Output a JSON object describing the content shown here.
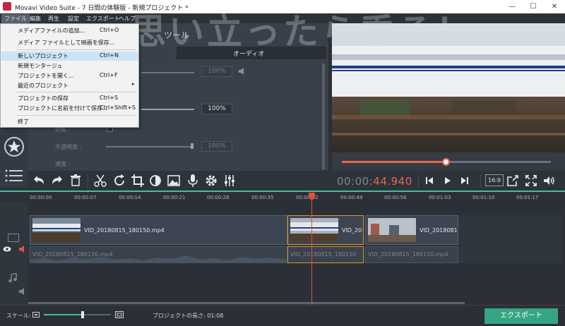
{
  "window": {
    "title": "Movavi Video Suite - 7 日間の体験版 - 新規プロジェクト *",
    "minimize": "—",
    "maximize": "☐",
    "close": "✕"
  },
  "menubar": [
    "ファイル",
    "編集",
    "再生",
    "設定",
    "エクスポート",
    "ヘルプ"
  ],
  "file_menu": {
    "items": [
      {
        "label": "メディアファイルの追加...",
        "shortcut": "Ctrl+O"
      },
      {
        "label": "メディア ファイルとして映画を保存...",
        "shortcut": ""
      },
      {
        "label": "新しいプロジェクト",
        "shortcut": "Ctrl+N",
        "highlighted": true
      },
      {
        "label": "新規モンタージュ",
        "shortcut": ""
      },
      {
        "label": "プロジェクトを開く...",
        "shortcut": "Ctrl+F"
      },
      {
        "label": "最近のプロジェクト",
        "shortcut": "",
        "submenu": true
      },
      {
        "label": "プロジェクトの保存",
        "shortcut": "Ctrl+S"
      },
      {
        "label": "プロジェクトに名前を付けて保存...",
        "shortcut": "Ctrl+Shift+S"
      },
      {
        "label": "終了",
        "shortcut": ""
      }
    ]
  },
  "tool_panel": {
    "heading": "ツール",
    "tab": "オーディオ",
    "value_1": "100%",
    "value_2": "100%",
    "value_3": "100%",
    "opacity_label": "不透明度 :",
    "fx_label": "逆転 :",
    "speed_label": "速度 :"
  },
  "preview": {
    "overlay_text": "思い立ったら乗る！",
    "progress": 0.5
  },
  "toolbar": {
    "timecode_main": "00:00:",
    "timecode_ms": "44.940",
    "aspect": "16:9"
  },
  "ruler": [
    "00:00:00",
    "00:00:07",
    "00:00:14",
    "00:00:21",
    "00:00:28",
    "00:00:35",
    "00:00:42",
    "00:00:49",
    "00:00:56",
    "00:01:03",
    "00:01:10",
    "00:01:17"
  ],
  "timeline": {
    "video_clips": [
      "VID_20180815_180150.mp4",
      "VID_20",
      "VID_2018081"
    ],
    "audio_clips": [
      "VID_20180815_180150.mp4",
      "VID_20180815_180150",
      "VID_20180815_180150.mp4"
    ]
  },
  "status": {
    "scale_label": "スケール:",
    "scale_level": 0.58,
    "length": "プロジェクトの長さ: 01:08",
    "export": "エクスポート"
  }
}
